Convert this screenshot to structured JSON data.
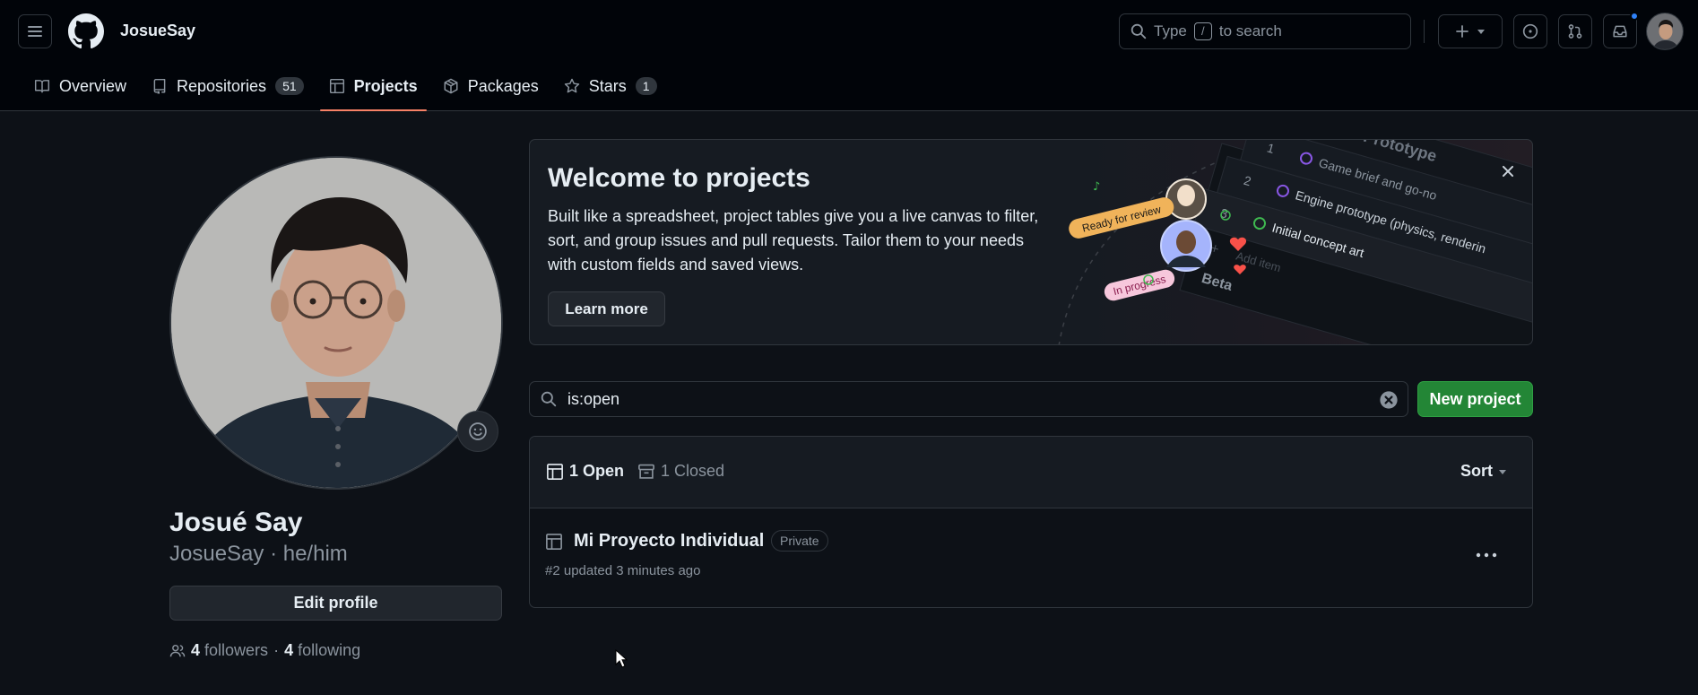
{
  "header": {
    "username": "JosueSay",
    "search": {
      "prefix": "Type",
      "key": "/",
      "suffix": "to search"
    }
  },
  "nav": {
    "tabs": [
      {
        "label": "Overview",
        "icon": "book-icon"
      },
      {
        "label": "Repositories",
        "icon": "repo-icon",
        "count": "51"
      },
      {
        "label": "Projects",
        "icon": "table-icon",
        "active": true
      },
      {
        "label": "Packages",
        "icon": "package-icon"
      },
      {
        "label": "Stars",
        "icon": "star-icon",
        "count": "1"
      }
    ]
  },
  "profile": {
    "name": "Josué Say",
    "login_line": "JosueSay · he/him",
    "edit_label": "Edit profile",
    "followers_count": "4",
    "followers_label": "followers",
    "separator": "·",
    "following_count": "4",
    "following_label": "following"
  },
  "banner": {
    "title": "Welcome to projects",
    "description": "Built like a spreadsheet, project tables give you a live canvas to filter, sort, and group issues and pull requests. Tailor them to your needs with custom fields and saved views.",
    "learn_more": "Learn more",
    "illustration": {
      "group_label": "Prototype",
      "rows": [
        {
          "num": "1",
          "text": "Game brief and go-no"
        },
        {
          "num": "2",
          "text": "Engine prototype (physics, renderin"
        },
        {
          "num": "3",
          "text": "Initial concept art"
        }
      ],
      "add_item": "Add item",
      "tag_ready": "Ready for review",
      "tag_progress": "In progress",
      "next_group": "Beta"
    }
  },
  "filter": {
    "value": "is:open"
  },
  "new_project_label": "New project",
  "list": {
    "open_tab": "1 Open",
    "closed_tab": "1 Closed",
    "sort_label": "Sort",
    "items": [
      {
        "title": "Mi Proyecto Individual",
        "badge": "Private",
        "meta": "#2 updated 3 minutes ago"
      }
    ]
  },
  "colors": {
    "background": "#0d1117",
    "header_bg": "#010409",
    "border": "#30363d",
    "accent_tab": "#f78166",
    "primary_button": "#238636",
    "notification": "#2f81f7"
  }
}
